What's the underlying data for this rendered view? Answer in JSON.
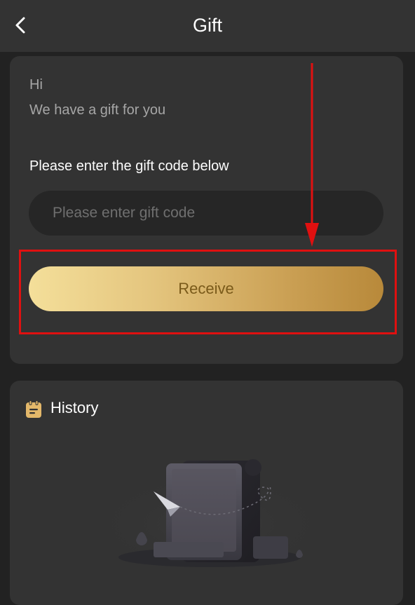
{
  "header": {
    "title": "Gift",
    "back_icon": "chevron-left-icon"
  },
  "gift_card": {
    "greeting": "Hi",
    "subtitle": "We have a gift for you",
    "instruction": "Please enter the gift code below",
    "code_input": {
      "value": "",
      "placeholder": "Please enter gift code"
    },
    "receive_label": "Receive"
  },
  "history": {
    "title": "History",
    "icon": "clipboard-icon"
  },
  "colors": {
    "background": "#222222",
    "card": "#333333",
    "gold_start": "#f4df9a",
    "gold_end": "#b8893a",
    "annotation_red": "#e01010"
  }
}
